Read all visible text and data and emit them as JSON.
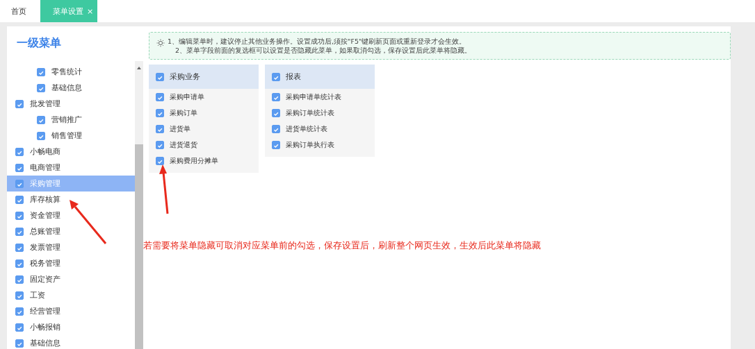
{
  "tabs": [
    {
      "label": "首页",
      "selected": false
    },
    {
      "label": "菜单设置",
      "selected": true,
      "close": "×"
    }
  ],
  "sidebar": {
    "title": "一级菜单",
    "items": [
      {
        "children": [
          {
            "label": "零售统计",
            "checked": true,
            "selected": false
          },
          {
            "label": "基础信息",
            "checked": true,
            "selected": false
          }
        ]
      },
      {
        "label": "批发管理",
        "checked": true,
        "selected": false,
        "children": [
          {
            "label": "营销推广",
            "checked": true,
            "selected": false
          },
          {
            "label": "销售管理",
            "checked": true,
            "selected": false
          }
        ]
      },
      {
        "label": "小畅电商",
        "checked": true,
        "selected": false
      },
      {
        "label": "电商管理",
        "checked": true,
        "selected": false
      },
      {
        "label": "采购管理",
        "checked": true,
        "selected": true
      },
      {
        "label": "库存核算",
        "checked": true,
        "selected": false
      },
      {
        "label": "资金管理",
        "checked": true,
        "selected": false
      },
      {
        "label": "总账管理",
        "checked": true,
        "selected": false
      },
      {
        "label": "发票管理",
        "checked": true,
        "selected": false
      },
      {
        "label": "税务管理",
        "checked": true,
        "selected": false
      },
      {
        "label": "固定资产",
        "checked": true,
        "selected": false
      },
      {
        "label": "工资",
        "checked": true,
        "selected": false
      },
      {
        "label": "经营管理",
        "checked": true,
        "selected": false
      },
      {
        "label": "小畅报销",
        "checked": true,
        "selected": false
      },
      {
        "label": "基础信息",
        "checked": true,
        "selected": false
      }
    ]
  },
  "notice": [
    "1、编辑菜单时，建议停止其他业务操作。设置成功后,须按\"F5\"键刷新页面或重新登录才会生效。",
    "2、菜单字段前面的复选框可以设置是否隐藏此菜单，如果取消勾选，保存设置后此菜单将隐藏。"
  ],
  "groups": [
    {
      "title": "采购业务",
      "checked": true,
      "items": [
        {
          "label": "采购申请单",
          "checked": true
        },
        {
          "label": "采购订单",
          "checked": true
        },
        {
          "label": "进货单",
          "checked": true
        },
        {
          "label": "进货退货",
          "checked": true
        },
        {
          "label": "采购费用分摊单",
          "checked": true
        }
      ]
    },
    {
      "title": "报表",
      "checked": true,
      "items": [
        {
          "label": "采购申请单统计表",
          "checked": true
        },
        {
          "label": "采购订单统计表",
          "checked": true
        },
        {
          "label": "进货单统计表",
          "checked": true
        },
        {
          "label": "采购订单执行表",
          "checked": true
        }
      ]
    }
  ],
  "annotation": {
    "text": "若需要将菜单隐藏可取消对应菜单前的勾选，保存设置后，刷新整个网页生效，生效后此菜单将隐藏"
  }
}
